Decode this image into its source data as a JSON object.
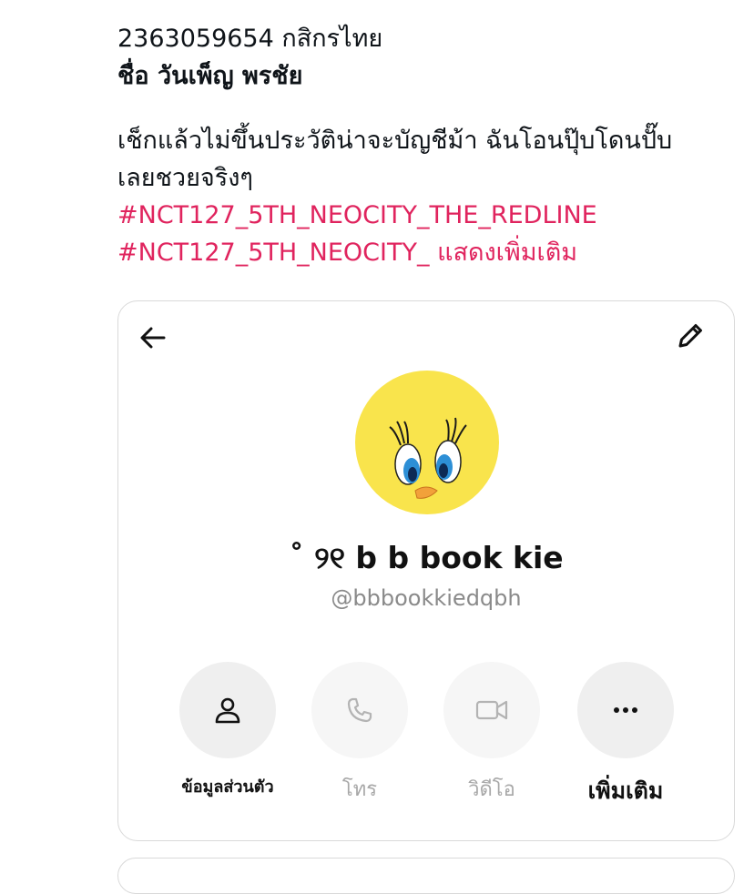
{
  "post": {
    "line1": "2363059654 กสิกรไทย",
    "name_prefix": "ชื่อ ",
    "name": "วันเพ็ญ พรชัย",
    "body_line1": "เช็กแล้วไม่ขึ้นประวัติน่าจะบัญชีม้า ฉันโอนปุ๊บโดนปั๊บ",
    "body_line2": "เลยชวยจริงๆ",
    "hashtag1": "#NCT127_5TH_NEOCITY_THE_REDLINE",
    "hashtag2": "#NCT127_5TH_NEOCITY_",
    "show_more": " แสดงเพิ่มเติม"
  },
  "profile_card": {
    "display_name": "˚ ୨୧ b b book kie",
    "handle": "@bbbookkiedqbh",
    "avatar_icon": "tweety-bird-avatar",
    "actions": [
      {
        "label": "ข้อมูลส่วนตัว",
        "icon": "person-icon",
        "enabled": true
      },
      {
        "label": "โทร",
        "icon": "phone-icon",
        "enabled": false
      },
      {
        "label": "วิดีโอ",
        "icon": "video-icon",
        "enabled": false
      },
      {
        "label": "เพิ่มเติม",
        "icon": "more-icon",
        "enabled": true
      }
    ],
    "colors": {
      "avatar_bg": "#f9e44c",
      "hashtag": "#e0245e"
    }
  }
}
